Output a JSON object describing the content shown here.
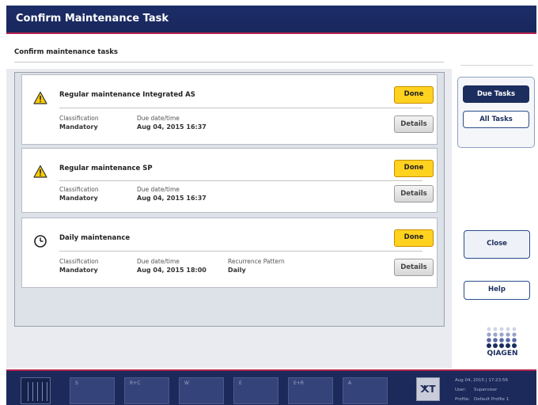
{
  "window": {
    "title": "Confirm Maintenance Task"
  },
  "main": {
    "heading": "Confirm maintenance tasks",
    "tasks": [
      {
        "icon": "warning-icon",
        "title": "Regular maintenance Integrated AS",
        "done_label": "Done",
        "details_label": "Details",
        "classification_label": "Classification",
        "classification": "Mandatory",
        "due_label": "Due date/time",
        "due": "Aug 04, 2015 16:37"
      },
      {
        "icon": "warning-icon",
        "title": "Regular maintenance SP",
        "done_label": "Done",
        "details_label": "Details",
        "classification_label": "Classification",
        "classification": "Mandatory",
        "due_label": "Due date/time",
        "due": "Aug 04, 2015 16:37"
      },
      {
        "icon": "clock-icon",
        "title": "Daily maintenance",
        "done_label": "Done",
        "details_label": "Details",
        "classification_label": "Classification",
        "classification": "Mandatory",
        "due_label": "Due date/time",
        "due": "Aug 04, 2015 18:00",
        "recurrence_label": "Recurrence Pattern",
        "recurrence": "Daily"
      }
    ]
  },
  "side": {
    "due_tasks": "Due Tasks",
    "all_tasks": "All Tasks",
    "close": "Close",
    "help": "Help",
    "logo_text": "QIAGEN"
  },
  "taskbar": {
    "slots": [
      "S",
      "R+C",
      "W",
      "E",
      "E+R",
      "A"
    ],
    "tool_icon": "tools-icon",
    "tool_glyph": "ⵅT",
    "datetime": "Aug 04, 2015 | 17:23:56",
    "user_label": "User:",
    "user": "Supervisor",
    "profile_label": "Profile:",
    "profile": "Default Profile 1"
  },
  "colors": {
    "title_bar": "#1d2d67",
    "accent_line": "#b2234e",
    "done_button": "#ffd21f",
    "primary_button": "#1c2e5e"
  }
}
